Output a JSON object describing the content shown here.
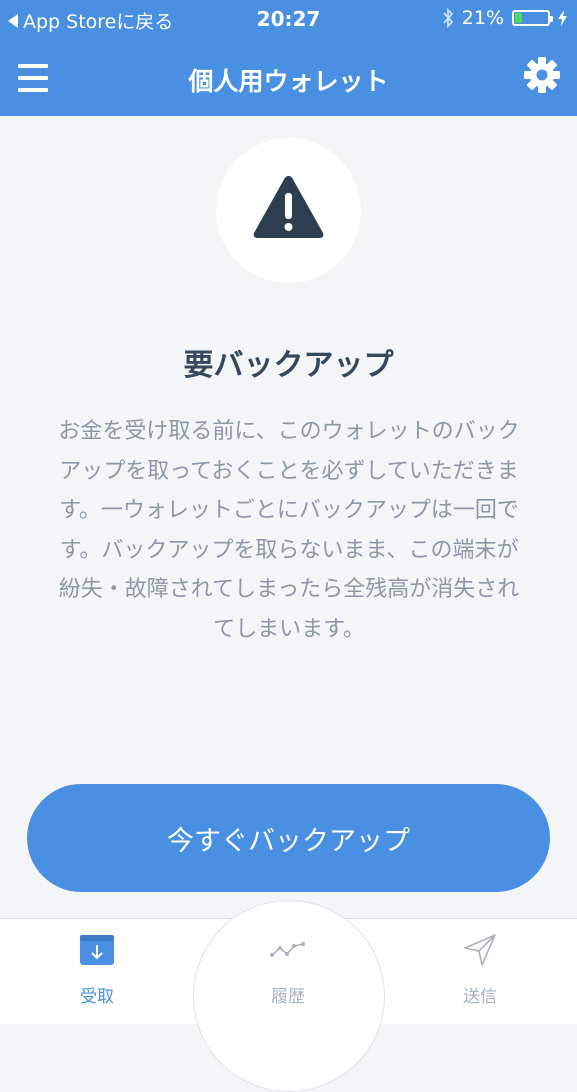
{
  "status_bar": {
    "back_label": "App Storeに戻る",
    "time": "20:27",
    "battery_percent": "21%",
    "battery_level": 0.21,
    "icons": [
      "back-triangle-icon",
      "bluetooth-icon",
      "battery-icon",
      "charging-bolt-icon"
    ]
  },
  "header": {
    "title": "個人用ウォレット",
    "menu_icon": "hamburger-menu-icon",
    "settings_icon": "gear-icon"
  },
  "main": {
    "alert_icon": "warning-triangle-icon",
    "heading": "要バックアップ",
    "message": "お金を受け取る前に、このウォレットのバックアップを取っておくことを必ずしていただきます。一ウォレットごとにバックアップは一回です。バックアップを取らないまま、この端末が紛失・故障されてしまったら全残高が消失されてしまいます。",
    "backup_button_label": "今すぐバックアップ"
  },
  "tabs": [
    {
      "label": "受取",
      "icon": "receive-tray-icon",
      "active": true
    },
    {
      "label": "履歴",
      "icon": "history-chart-icon",
      "active": false
    },
    {
      "label": "送信",
      "icon": "send-paper-plane-icon",
      "active": false
    }
  ],
  "colors": {
    "primary": "#4a90e2",
    "background": "#f4f5f7",
    "heading_text": "#34495e",
    "body_text": "#8c98a8",
    "inactive_tab": "#a9b3bf",
    "warning_icon": "#2c3e50"
  }
}
